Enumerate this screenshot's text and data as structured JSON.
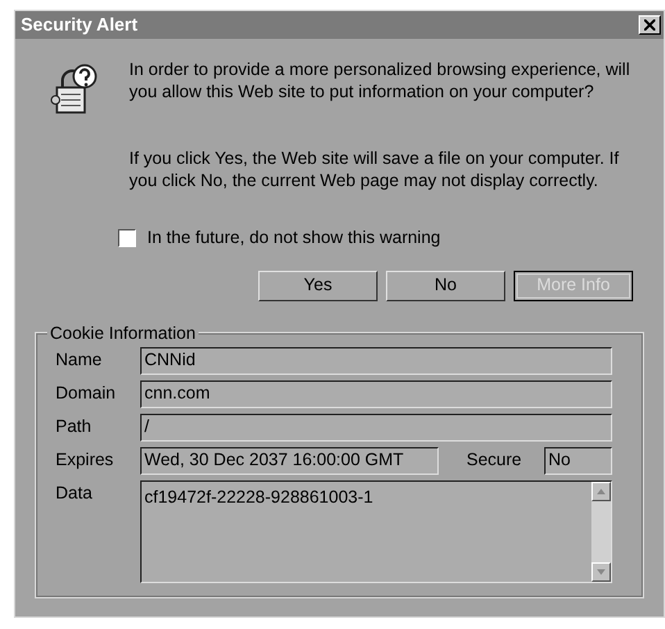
{
  "window": {
    "title": "Security Alert"
  },
  "message": [
    "In order to provide a more personalized browsing experience, will you allow this Web site to put information on your computer?",
    "If you click Yes, the Web site will save a file on your computer. If you click No, the current Web page may not display correctly."
  ],
  "checkbox": {
    "label": "In the future, do not show this warning",
    "checked": false
  },
  "buttons": [
    {
      "label": "Yes",
      "disabled": false,
      "default": false
    },
    {
      "label": "No",
      "disabled": false,
      "default": false
    },
    {
      "label": "More Info",
      "disabled": true,
      "default": true
    }
  ],
  "cookie_information": {
    "title": "Cookie Information",
    "fields": [
      {
        "label": "Name",
        "value": "CNNid"
      },
      {
        "label": "Domain",
        "value": "cnn.com"
      },
      {
        "label": "Path",
        "value": "/"
      }
    ],
    "expires": {
      "label": "Expires",
      "value": "Wed, 30 Dec 2037 16:00:00 GMT"
    },
    "secure": {
      "label": "Secure",
      "value": "No"
    },
    "data": {
      "label": "Data",
      "value": "cf19472f-22228-928861003-1"
    }
  }
}
